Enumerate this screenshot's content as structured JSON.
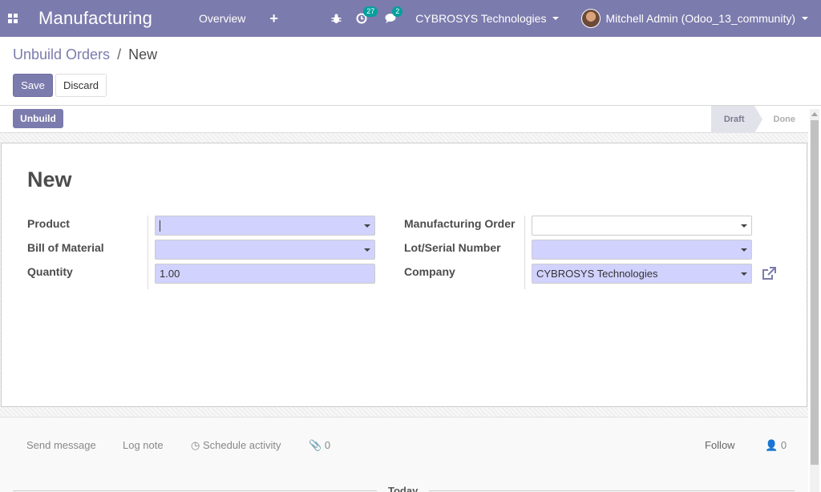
{
  "navbar": {
    "app_name": "Manufacturing",
    "menu_overview": "Overview",
    "plus_label": "+",
    "activity_count": "27",
    "message_count": "2",
    "company": "CYBROSYS Technologies",
    "user": "Mitchell Admin (Odoo_13_community)",
    "bg_color": "#7c7bad"
  },
  "control_panel": {
    "breadcrumb_parent": "Unbuild Orders",
    "breadcrumb_sep": "/",
    "breadcrumb_current": "New",
    "save_label": "Save",
    "discard_label": "Discard"
  },
  "statusbar": {
    "unbuild_label": "Unbuild",
    "stages": [
      "Draft",
      "Done"
    ],
    "active_stage": "Draft"
  },
  "form": {
    "title": "New",
    "left": {
      "product_label": "Product",
      "product_value": "",
      "bom_label": "Bill of Material",
      "bom_value": "",
      "quantity_label": "Quantity",
      "quantity_value": "1.00"
    },
    "right": {
      "mo_label": "Manufacturing Order",
      "mo_value": "",
      "lot_label": "Lot/Serial Number",
      "lot_value": "",
      "company_label": "Company",
      "company_value": "CYBROSYS Technologies"
    }
  },
  "chatter": {
    "send_message": "Send message",
    "log_note": "Log note",
    "schedule_activity": "Schedule activity",
    "attachments_count": "0",
    "follow": "Follow",
    "followers_count": "0",
    "today": "Today"
  }
}
